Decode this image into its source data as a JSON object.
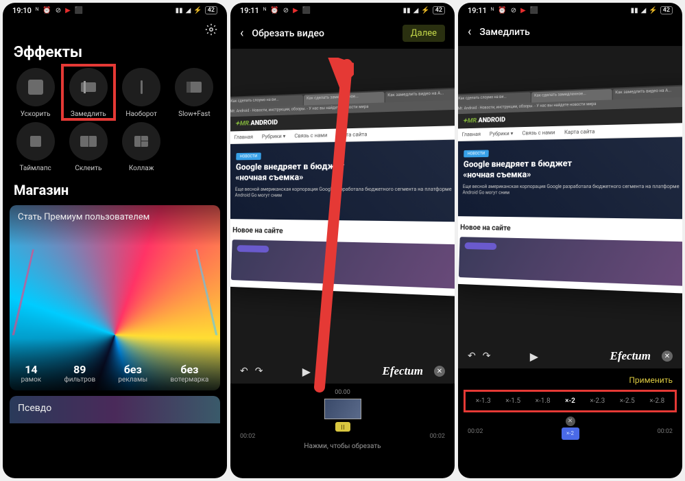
{
  "screen1": {
    "status": {
      "time": "19:10",
      "battery": "42"
    },
    "title": "Эффекты",
    "effects": [
      {
        "label": "Ускорить"
      },
      {
        "label": "Замедлить"
      },
      {
        "label": "Наоборот"
      },
      {
        "label": "Slow+Fast"
      },
      {
        "label": "Таймлапс"
      },
      {
        "label": "Склеить"
      },
      {
        "label": "Коллаж"
      }
    ],
    "store_title": "Магазин",
    "premium": {
      "cta": "Стать Премиум пользователем",
      "stats": [
        {
          "num": "14",
          "label": "рамок"
        },
        {
          "num": "89",
          "label": "фильтров"
        },
        {
          "num": "без",
          "label": "рекламы"
        },
        {
          "num": "без",
          "label": "вотермарка"
        }
      ]
    },
    "pseudo": "Псевдо"
  },
  "screen2": {
    "status": {
      "time": "19:11",
      "battery": "42"
    },
    "nav": {
      "title": "Обрезать видео",
      "next": "Далее"
    },
    "brand": "Efectum",
    "trim": {
      "top_time": "00.00",
      "left_time": "00:02",
      "right_time": "00:02",
      "hint": "Нажми, чтобы обрезать"
    }
  },
  "screen3": {
    "status": {
      "time": "19:11",
      "battery": "42"
    },
    "nav": {
      "title": "Замедлить"
    },
    "brand": "Efectum",
    "apply": "Применить",
    "speeds": [
      "×-1.3",
      "×-1.5",
      "×-1.8",
      "×-2",
      "×-2.3",
      "×-2.5",
      "×-2.8"
    ],
    "speed_selected_index": 3,
    "timeline": {
      "left": "00:02",
      "right": "00:02",
      "chip": "×-2"
    }
  },
  "webpage": {
    "tabs": [
      "Как сделать слоумо на ви...",
      "Как сделать замедленное...",
      "Как замедлить видео на А..."
    ],
    "url": "Mr. Android - Новости, инструкции, обзоры. - У нас вы найдете новости мира",
    "logo_a": "MR.",
    "logo_b": "ANDROID",
    "nav": [
      "Главная",
      "Рубрики ▾",
      "Связь с нами",
      "Карта сайта"
    ],
    "hero_badge": "НОВОСТИ",
    "hero_title_1": "Google внедряет в бюджет",
    "hero_title_2": "«ночная съемка»",
    "hero_sub": "Еще весной американская корпорация Google разработала бюджетного сегмента на платформе Android Go могут сним",
    "section": "Новое на сайте"
  }
}
